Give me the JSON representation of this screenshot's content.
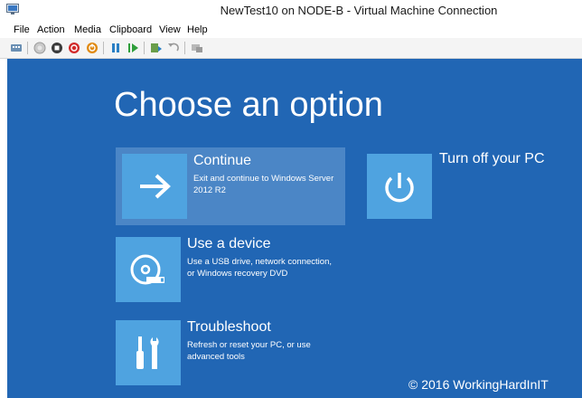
{
  "window": {
    "title": "NewTest10 on NODE-B - Virtual Machine Connection",
    "app_icon": "vm-connection-icon"
  },
  "menu": [
    "File",
    "Action",
    "Media",
    "Clipboard",
    "View",
    "Help"
  ],
  "toolbar": {
    "icons": [
      "ctrl-alt-del-icon",
      "start-icon",
      "turn-off-icon",
      "shutdown-icon",
      "save-icon",
      "pause-icon",
      "resume-icon",
      "checkpoint-icon",
      "revert-icon",
      "enhanced-session-icon"
    ]
  },
  "screen": {
    "heading": "Choose an option",
    "options": [
      {
        "title": "Continue",
        "description": "Exit and continue to Windows Server 2012 R2",
        "icon": "arrow-right-icon"
      },
      {
        "title": "Use a device",
        "description": "Use a USB drive, network connection, or Windows recovery DVD",
        "icon": "disc-device-icon"
      },
      {
        "title": "Troubleshoot",
        "description": "Refresh or reset your PC, or use advanced tools",
        "icon": "tools-icon"
      },
      {
        "title": "Turn off your PC",
        "icon": "power-icon"
      }
    ],
    "colors": {
      "background": "#2166b4",
      "tile": "#4fa3e0",
      "selected": "#4b86c6"
    }
  },
  "watermark": "© 2016 WorkingHardInIT"
}
